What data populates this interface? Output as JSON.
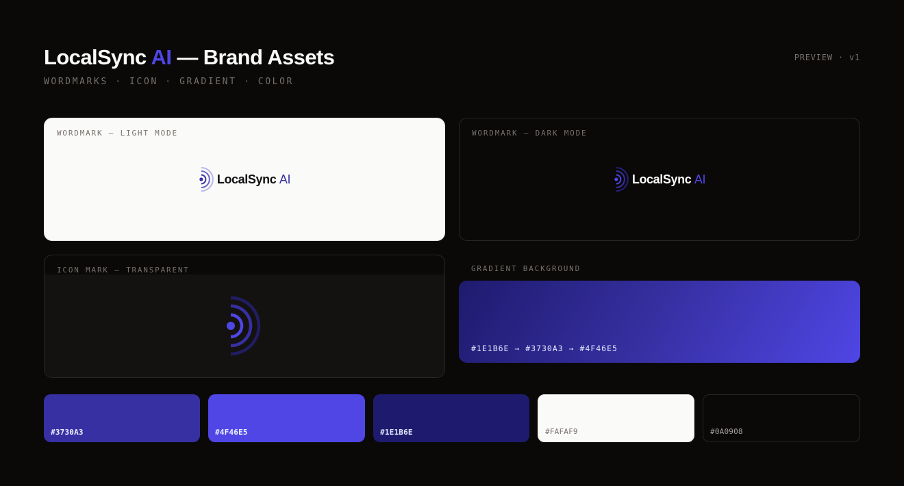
{
  "header": {
    "title_main": "LocalSync ",
    "title_accent": "AI",
    "title_rest": " — Brand Assets",
    "subtitle": "WORDMARKS · ICON · GRADIENT · COLOR",
    "preview_tag": "PREVIEW · v1"
  },
  "cards": {
    "light": {
      "label": "WORDMARK — LIGHT MODE",
      "brand": "LocalSync",
      "brand_ai": "AI"
    },
    "dark": {
      "label": "WORDMARK — DARK MODE",
      "brand": "LocalSync",
      "brand_ai": "AI"
    },
    "icon": {
      "label": "ICON MARK — TRANSPARENT"
    },
    "gradient": {
      "label": "GRADIENT BACKGROUND",
      "caption": "#1E1B6E → #3730A3 → #4F46E5"
    }
  },
  "swatches": [
    {
      "hex": "#3730A3",
      "label": "#3730A3"
    },
    {
      "hex": "#4F46E5",
      "label": "#4F46E5"
    },
    {
      "hex": "#1E1B6E",
      "label": "#1E1B6E"
    },
    {
      "hex": "#FAFAF9",
      "label": "#FAFAF9"
    },
    {
      "hex": "#0A0908",
      "label": "#0A0908"
    }
  ],
  "colors": {
    "accent": "#4F46E5",
    "primary": "#3730A3",
    "deep": "#1E1B6E",
    "light": "#FAFAF9",
    "dark": "#0A0908"
  }
}
